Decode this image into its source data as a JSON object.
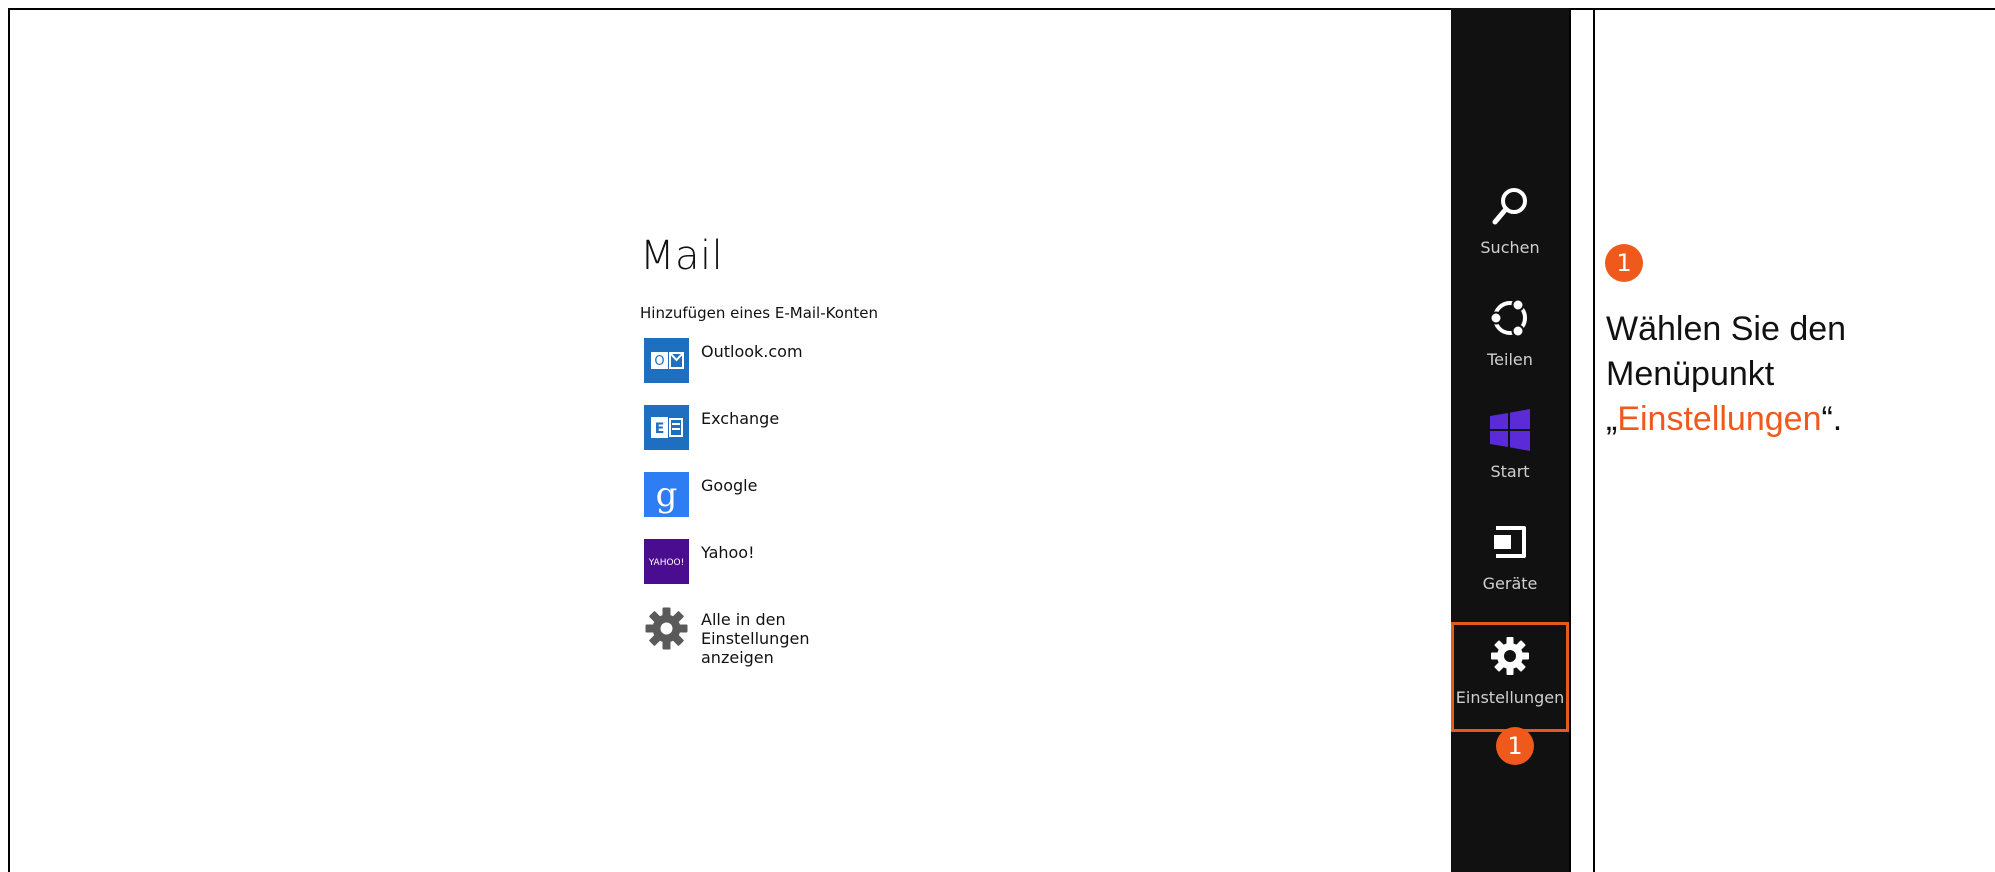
{
  "mail_panel": {
    "title": "Mail",
    "subtitle": "Hinzufügen eines E-Mail-Konten",
    "accounts": [
      {
        "label": "Outlook.com",
        "icon": "outlook-icon",
        "color": "#1e6fc0"
      },
      {
        "label": "Exchange",
        "icon": "exchange-icon",
        "color": "#1e6fc0"
      },
      {
        "label": "Google",
        "icon": "google-icon",
        "color": "#2f7df2"
      },
      {
        "label": "Yahoo!",
        "icon": "yahoo-icon",
        "color": "#4a0d8f",
        "icon_text": "YAHOO!"
      },
      {
        "label": "Alle in den Einstellungen anzeigen",
        "icon": "gear-icon",
        "color": "#5a5a5a"
      }
    ],
    "outlook_icon_letter": "O",
    "exchange_icon_letter": "E"
  },
  "charms": {
    "background": "#111111",
    "items": [
      {
        "label": "Suchen",
        "icon": "search-icon"
      },
      {
        "label": "Teilen",
        "icon": "share-icon"
      },
      {
        "label": "Start",
        "icon": "windows-logo-icon"
      },
      {
        "label": "Geräte",
        "icon": "devices-icon"
      },
      {
        "label": "Einstellungen",
        "icon": "settings-gear-icon",
        "highlighted": true
      }
    ]
  },
  "annotation": {
    "accent_color": "#f0591c",
    "badge_number": "1",
    "instruction_prefix": "Wählen Sie den Menüpunkt „",
    "instruction_highlight": "Einstellungen",
    "instruction_suffix": "“."
  }
}
